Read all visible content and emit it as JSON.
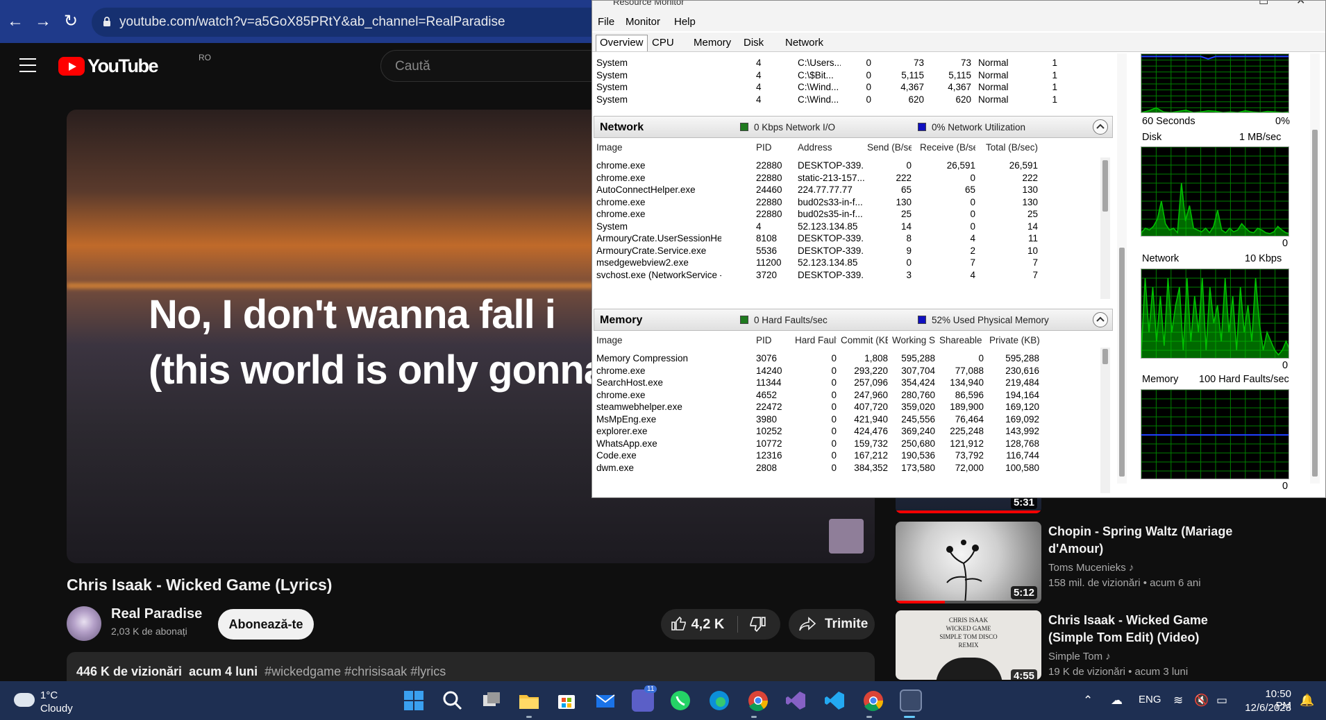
{
  "chrome": {
    "url": "youtube.com/watch?v=a5GoX85PRtY&ab_channel=RealParadise"
  },
  "youtube": {
    "logo_text": "YouTube",
    "country_code": "RO",
    "search_placeholder": "Caută",
    "lyrics_line1": "No, I don't wanna fall i",
    "lyrics_line2": "(this world is only gonna brea",
    "video_title": "Chris Isaak - Wicked Game (Lyrics)",
    "channel_name": "Real Paradise",
    "channel_subs": "2,03 K de abonați",
    "subscribe_label": "Abonează-te",
    "like_count": "4,2 K",
    "share_label": "Trimite",
    "views": "446 K de vizionări",
    "uploaded": "acum 4 luni",
    "hashtags": "#wickedgame #chrisisaak #lyrics",
    "recommendations": [
      {
        "title": "",
        "duration": "5:31",
        "channel": "",
        "meta": ""
      },
      {
        "title": "Chopin - Spring Waltz (Mariage d'Amour)",
        "duration": "5:12",
        "channel": "Toms Mucenieks",
        "meta": "158 mil. de vizionări • acum 6 ani"
      },
      {
        "title": "Chris Isaak - Wicked Game (Simple Tom Edit) (Video)",
        "duration": "4:55",
        "channel": "Simple Tom",
        "meta": "19 K de vizionări • acum 3 luni",
        "thumb_text": "CHRIS ISAAK WICKED GAME SIMPLE TOM DISCO REMIX"
      }
    ]
  },
  "resmon": {
    "title": "Resource Monitor",
    "menu": [
      "File",
      "Monitor",
      "Help"
    ],
    "tabs": [
      "Overview",
      "CPU",
      "Memory",
      "Disk",
      "Network"
    ],
    "disk_rows": [
      [
        "System",
        "4",
        "C:\\Users...",
        "0",
        "73",
        "73",
        "Normal",
        "1"
      ],
      [
        "System",
        "4",
        "C:\\$Bit...",
        "0",
        "5,115",
        "5,115",
        "Normal",
        "1"
      ],
      [
        "System",
        "4",
        "C:\\Wind...",
        "0",
        "4,367",
        "4,367",
        "Normal",
        "1"
      ],
      [
        "System",
        "4",
        "C:\\Wind...",
        "0",
        "620",
        "620",
        "Normal",
        "1"
      ]
    ],
    "network": {
      "title": "Network",
      "stat1": "0 Kbps Network I/O",
      "stat2": "0% Network Utilization",
      "headers": [
        "Image",
        "PID",
        "Address",
        "Send (B/sec)",
        "Receive (B/sec)",
        "Total (B/sec)"
      ],
      "rows": [
        [
          "chrome.exe",
          "22880",
          "DESKTOP-339...",
          "0",
          "26,591",
          "26,591"
        ],
        [
          "chrome.exe",
          "22880",
          "static-213-157...",
          "222",
          "0",
          "222"
        ],
        [
          "AutoConnectHelper.exe",
          "24460",
          "224.77.77.77",
          "65",
          "65",
          "130"
        ],
        [
          "chrome.exe",
          "22880",
          "bud02s33-in-f...",
          "130",
          "0",
          "130"
        ],
        [
          "chrome.exe",
          "22880",
          "bud02s35-in-f...",
          "25",
          "0",
          "25"
        ],
        [
          "System",
          "4",
          "52.123.134.85",
          "14",
          "0",
          "14"
        ],
        [
          "ArmouryCrate.UserSessionHelper...",
          "8108",
          "DESKTOP-339...",
          "8",
          "4",
          "11"
        ],
        [
          "ArmouryCrate.Service.exe",
          "5536",
          "DESKTOP-339...",
          "9",
          "2",
          "10"
        ],
        [
          "msedgewebview2.exe",
          "11200",
          "52.123.134.85",
          "0",
          "7",
          "7"
        ],
        [
          "svchost.exe (NetworkService -p)",
          "3720",
          "DESKTOP-339...",
          "3",
          "4",
          "7"
        ]
      ]
    },
    "memory": {
      "title": "Memory",
      "stat1": "0 Hard Faults/sec",
      "stat2": "52% Used Physical Memory",
      "headers": [
        "Image",
        "PID",
        "Hard Fault...",
        "Commit (KB)",
        "Working S...",
        "Shareable ...",
        "Private (KB)"
      ],
      "rows": [
        [
          "Memory Compression",
          "3076",
          "0",
          "1,808",
          "595,288",
          "0",
          "595,288"
        ],
        [
          "chrome.exe",
          "14240",
          "0",
          "293,220",
          "307,704",
          "77,088",
          "230,616"
        ],
        [
          "SearchHost.exe",
          "11344",
          "0",
          "257,096",
          "354,424",
          "134,940",
          "219,484"
        ],
        [
          "chrome.exe",
          "4652",
          "0",
          "247,960",
          "280,760",
          "86,596",
          "194,164"
        ],
        [
          "steamwebhelper.exe",
          "22472",
          "0",
          "407,720",
          "359,020",
          "189,900",
          "169,120"
        ],
        [
          "MsMpEng.exe",
          "3980",
          "0",
          "421,940",
          "245,556",
          "76,464",
          "169,092"
        ],
        [
          "explorer.exe",
          "10252",
          "0",
          "424,476",
          "369,240",
          "225,248",
          "143,992"
        ],
        [
          "WhatsApp.exe",
          "10772",
          "0",
          "159,732",
          "250,680",
          "121,912",
          "128,768"
        ],
        [
          "Code.exe",
          "12316",
          "0",
          "167,212",
          "190,536",
          "73,792",
          "116,744"
        ],
        [
          "dwm.exe",
          "2808",
          "0",
          "384,352",
          "173,580",
          "72,000",
          "100,580"
        ]
      ]
    },
    "graphs": {
      "cpu_footer_left": "60 Seconds",
      "cpu_footer_right": "0%",
      "disk_label": "Disk",
      "disk_scale": "1 MB/sec",
      "disk_zero": "0",
      "network_label": "Network",
      "network_scale": "10 Kbps",
      "network_zero": "0",
      "memory_label": "Memory",
      "memory_scale": "100 Hard Faults/sec",
      "memory_zero": "0"
    }
  },
  "taskbar": {
    "temperature": "1°C",
    "weather": "Cloudy",
    "teams_badge": "11",
    "language": "ENG",
    "time": "10:50 PM",
    "date": "12/6/2023"
  },
  "colors": {
    "graph_green": "#00c000",
    "graph_grid": "#008000",
    "graph_blue": "#2040ff",
    "yt_red": "#ff0000",
    "taskbar": "#1e2f52"
  }
}
